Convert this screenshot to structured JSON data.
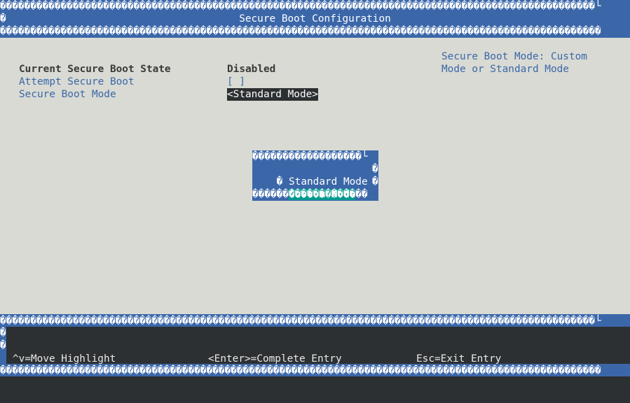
{
  "header": {
    "title": "Secure Boot Configuration",
    "border_top": "\u0000\u0000\u0000\u0000\u0000\u0000\u0000\u0000\u0000\u0000\u0000\u0000\u0000\u0000\u0000\u0000\u0000\u0000\u0000\u0000\u0000\u0000\u0000\u0000\u0000\u0000\u0000\u0000\u0000\u0000\u0000\u0000\u0000\u0000\u0000\u0000\u0000\u0000\u0000\u0000\u0000\u0000\u0000\u0000\u0000\u0000\u0000\u0000\u0000\u0000\u0000\u0000\u0000\u0000\u0000\u0000\u0000\u0000\u0000\u0000\u0000\u0000\u0000\u0000\u0000\u0000\u0000\u0000\u0000\u0000\u0000\u0000\u0000\u0000\u0000\u0000\u0000\u0000\u0000\u0000\u0000\u0000\u0000\u0000\u0000\u0000\u0000\u0000\u0000\u0000\u0000\u0000\u0000\u0000\u0000\u0000\u0000\u0000\u0000\u0000\u0000\u0000\u0000\u0000\u0000\u0000\u0000\u0000\u0000\u0000\u0000\u0000\u0000\u0000\u0000\u0000\u0000\u0000\u0000\u0000\u0000\u0000\u0000\u0000\u0000\u0000\u0000\u0000\u0000\u0000\u0000\u0000\u0000\u0000\u0000\u0000\u0000\u0000\u0000\u0000\u0000\u0000\u0000\u0000\u0000\u0000\u0000\u0000\u0000\u0000\u0000\u0000\u0000\u0000",
    "border_glyph": "�",
    "corner_glyph": "└"
  },
  "settings": [
    {
      "label": "Current Secure Boot State",
      "value": "Disabled"
    },
    {
      "label": "Attempt Secure Boot",
      "value": "[ ]"
    },
    {
      "label": "Secure Boot Mode",
      "value": "<Standard Mode>"
    }
  ],
  "help_text": {
    "line1": "Secure Boot Mode: Custom",
    "line2": "Mode or Standard Mode"
  },
  "popup": {
    "options": [
      "Standard Mode",
      "Custom Mode"
    ],
    "highlighted": "Custom Mode"
  },
  "footer": {
    "move": "^v=Move Highlight",
    "enter": "<Enter>=Complete Entry",
    "esc": "Esc=Exit Entry"
  },
  "colors": {
    "bar_blue": "#3b67a9",
    "background": "#d8dad3",
    "dark": "#2d3032",
    "highlight": "#009a8e"
  }
}
